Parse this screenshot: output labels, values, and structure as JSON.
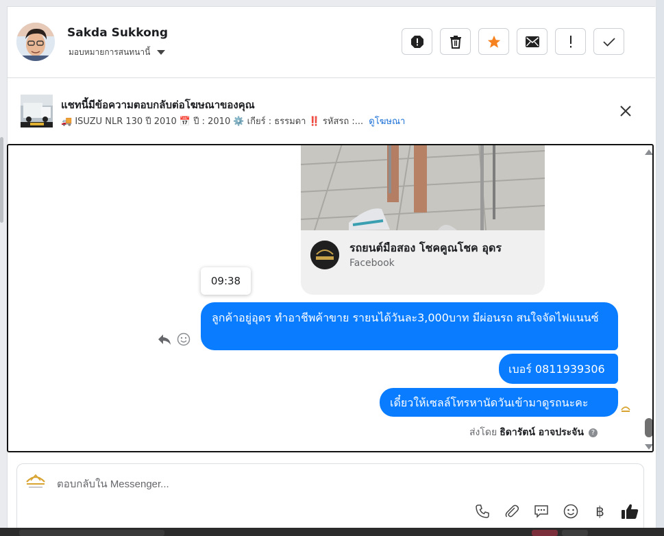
{
  "header": {
    "name": "Sakda Sukkong",
    "assign_label": "มอบหมายการสนทนานี้",
    "actions": [
      "spam-icon",
      "trash-icon",
      "star-icon",
      "mail-icon",
      "important-icon",
      "check-icon"
    ],
    "star_color": "#f5821f"
  },
  "ad_banner": {
    "title": "แชทนี้มีข้อความตอบกลับต่อโฆษณาของคุณ",
    "details": "🚚 ISUZU NLR 130 ปี 2010 📅 ปี : 2010 ⚙️ เกียร์ : ธรรมดา ‼️ รหัสรถ :...",
    "view_ad_link": "ดูโฆษณา"
  },
  "chat": {
    "shared_card": {
      "page_name": "รถยนต์มือสอง โชคคูณโชค อุดร",
      "source": "Facebook"
    },
    "timestamp": "09:38",
    "messages": [
      {
        "text": "ลูกค้าอยู่อุดร ทำอาชีพค้าขาย รายนได้วันละ3,000บาท มีผ่อนรถ สนใจจัดไฟแนนซ์"
      },
      {
        "text": "เบอร์ 0811939306"
      },
      {
        "text": "เดี๋ยวให้เซลล์โทรหานัดวันเข้ามาดูรถนะคะ"
      }
    ],
    "sent_by_prefix": "ส่งโดย",
    "sent_by_name": "ธิดารัตน์ อาจประจัน",
    "bubble_color": "#0a7cff"
  },
  "composer": {
    "placeholder": "ตอบกลับใน Messenger...",
    "tools": [
      "phone-icon",
      "attachment-icon",
      "saved-reply-icon",
      "emoji-icon",
      "baht-icon",
      "like-icon"
    ],
    "baht_symbol": "฿"
  }
}
